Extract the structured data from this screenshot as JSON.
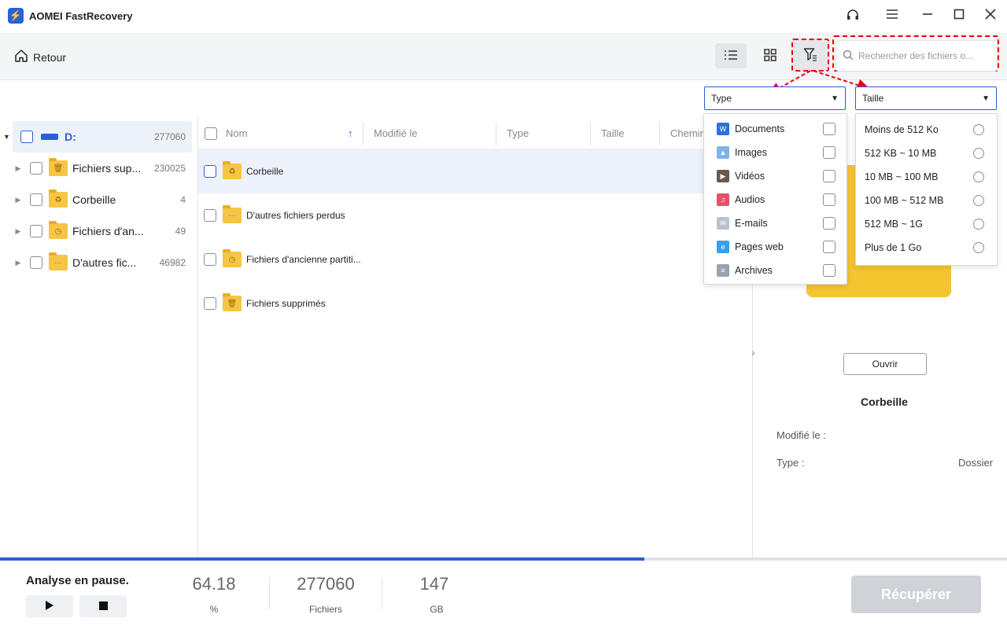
{
  "app": {
    "title": "AOMEI FastRecovery"
  },
  "toolbar": {
    "back_label": "Retour",
    "search_placeholder": "Rechercher des fichiers o..."
  },
  "filters": {
    "type_label": "Type",
    "size_label": "Taille"
  },
  "sidebar": {
    "drive": {
      "label": "D:",
      "count": "277060"
    },
    "items": [
      {
        "label": "Fichiers sup...",
        "count": "230025"
      },
      {
        "label": "Corbeille",
        "count": "4"
      },
      {
        "label": "Fichiers d'an...",
        "count": "49"
      },
      {
        "label": "D'autres fic...",
        "count": "46982"
      }
    ]
  },
  "list": {
    "columns": [
      "Nom",
      "Modifié le",
      "Type",
      "Taille",
      "Chemin"
    ],
    "rows": [
      "Corbeille",
      "D'autres fichiers perdus",
      "Fichiers d'ancienne partiti...",
      "Fichiers supprimés"
    ]
  },
  "type_menu": [
    "Documents",
    "Images",
    "Vidéos",
    "Audios",
    "E-mails",
    "Pages web",
    "Archives"
  ],
  "size_menu": [
    "Moins de 512 Ko",
    "512 KB ~ 10 MB",
    "10 MB ~ 100 MB",
    "100 MB ~ 512 MB",
    "512 MB ~ 1G",
    "Plus de 1 Go"
  ],
  "preview": {
    "open_label": "Ouvrir",
    "name": "Corbeille",
    "modified_label": "Modifié le :",
    "type_label": "Type :",
    "type_value": "Dossier"
  },
  "status": {
    "text": "Analyse en pause.",
    "progress": 0.64,
    "percent_value": "64.18",
    "percent_label": "%",
    "files_value": "277060",
    "files_label": "Fichiers",
    "size_value": "147",
    "size_label": "GB",
    "recover_label": "Récupérer"
  },
  "colors": {
    "accent": "#2a5fd6",
    "annotation": "#e00000"
  }
}
